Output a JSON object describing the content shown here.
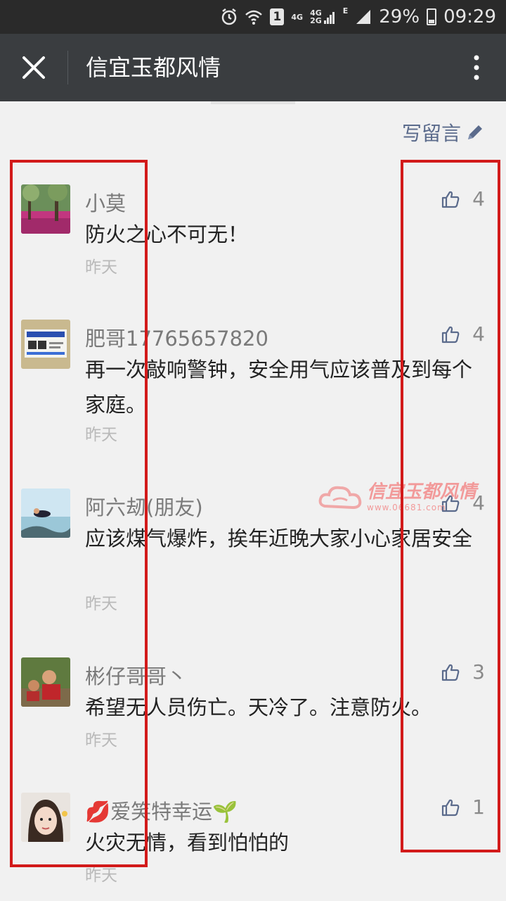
{
  "status_bar": {
    "sim": "1",
    "net_4g_a": "4G",
    "net_4g_b": "4G",
    "net_2g": "2G",
    "net_e": "E",
    "battery": "29%",
    "time": "09:29"
  },
  "header": {
    "title": "信宜玉都风情"
  },
  "write_message": "写留言",
  "comments": [
    {
      "name": "小莫",
      "text": "防火之心不可无！",
      "time": "昨天",
      "likes": "4"
    },
    {
      "name": "肥哥17765657820",
      "text": "再一次敲响警钟，安全用气应该普及到每个家庭。",
      "time": "昨天",
      "likes": "4"
    },
    {
      "name": "阿六刼(朋友)",
      "text": "应该煤气爆炸，挨年近晚大家小心家居安全",
      "time": "昨天",
      "likes": "4"
    },
    {
      "name": "彬仔哥哥丶",
      "text": "希望无人员伤亡。天冷了。注意防火。",
      "time": "昨天",
      "likes": "3"
    },
    {
      "name": "💋爱笑特幸运🌱",
      "text": "火灾无情，看到怕怕的",
      "time": "昨天",
      "likes": "1"
    }
  ],
  "watermark": {
    "name": "信宜玉都风情",
    "url": "www.06681.com"
  },
  "colors": {
    "status_bar_bg": "#2a2a2a",
    "header_bg": "#3a3d40",
    "page_bg": "#f1f1f1",
    "link": "#5b6b8c",
    "highlight_frame": "#d21a1a"
  }
}
